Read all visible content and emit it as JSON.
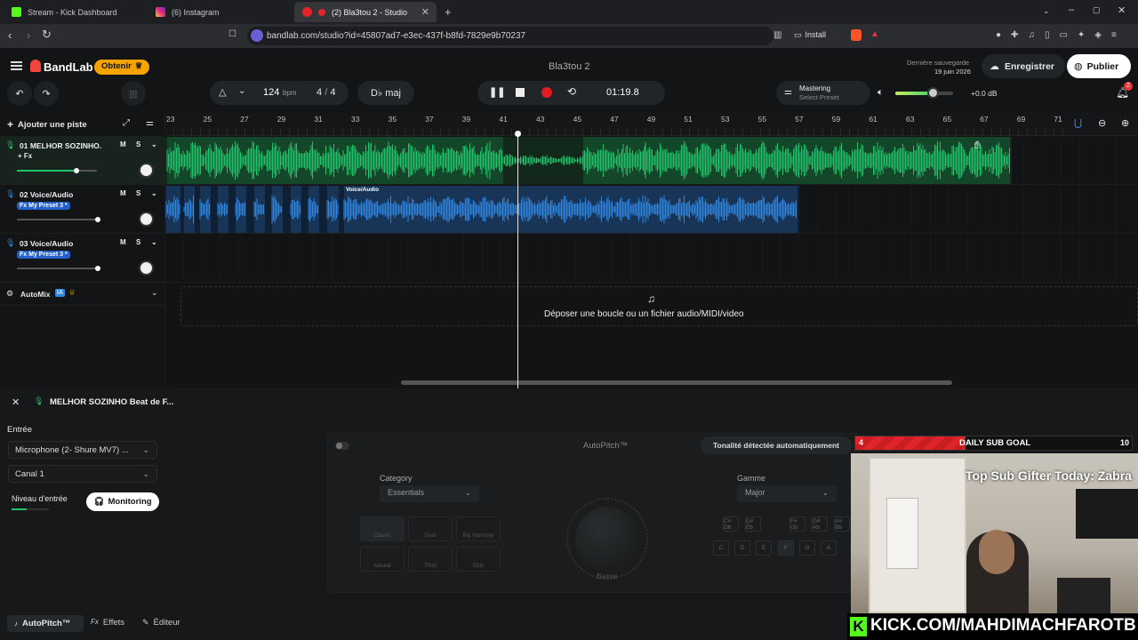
{
  "browser": {
    "tabs": [
      {
        "title": "Stream - Kick Dashboard",
        "favicon": "kick-icon"
      },
      {
        "title": "(6) Instagram",
        "favicon": "instagram-icon"
      },
      {
        "title": "(2) Bla3tou 2 - Studio",
        "favicon": "bandlab-icon"
      }
    ],
    "url": "bandlab.com/studio?id=45807ad7-e3ec-437f-b8fd-7829e9b70237",
    "install_label": "Install"
  },
  "header": {
    "brand": "BandLab",
    "obtenir": "Obtenir",
    "project_title": "Bla3tou 2",
    "last_save_label": "Dernière sauvegarde",
    "last_save_date": "19 juin 2026",
    "save_button": "Enregistrer",
    "publish_button": "Publier"
  },
  "transport": {
    "bpm_value": "124",
    "bpm_unit": "bpm",
    "time_sig_num": "4",
    "time_sig_den": "4",
    "key": "D♭ maj",
    "time": "01:19.8",
    "mastering_label": "Mastering",
    "mastering_preset": "Select Preset",
    "volume_db": "+0.0 dB",
    "notification_count": "2"
  },
  "toolbar": {
    "add_track": "Ajouter une piste"
  },
  "ruler": {
    "bars": [
      "23",
      "25",
      "27",
      "29",
      "31",
      "33",
      "35",
      "37",
      "39",
      "41",
      "43",
      "45",
      "47",
      "49",
      "51",
      "53",
      "55",
      "57",
      "59",
      "61",
      "63",
      "65",
      "67",
      "69",
      "71"
    ]
  },
  "tracks": [
    {
      "name": "01  MELHOR SOZINHO...",
      "fx": "+ Fx",
      "m": "M",
      "s": "S"
    },
    {
      "name": "02  Voice/Audio",
      "fx": "Fx My Preset 3 *",
      "m": "M",
      "s": "S"
    },
    {
      "name": "03  Voice/Audio",
      "fx": "Fx My Preset 3 *",
      "m": "M",
      "s": "S"
    }
  ],
  "clip2_label": "Voice/Audio",
  "automix": {
    "label": "AutoMix",
    "badge": "IA"
  },
  "dropzone": "Déposer une boucle ou un fichier audio/MIDI/video",
  "bottom_panel": {
    "track_title": "MELHOR SOZINHO Beat de F...",
    "input_label": "Entrée",
    "input_device": "Microphone (2- Shure MV7) ...",
    "channel": "Canal 1",
    "input_level_label": "Niveau d'entrée",
    "monitoring": "Monitoring",
    "autopitch_title": "AutoPitch™",
    "detected_key_btn": "Tonalité détectée automatiquement",
    "category_label": "Category",
    "category_value": "Essentials",
    "scale_label": "Gamme",
    "scale_value": "Major",
    "styles": [
      "Classic",
      "Duet",
      "Big Harmony",
      "Natural",
      "Third",
      "Chip"
    ],
    "knob_label": "Basse",
    "keys_top": [
      "C#\nDb",
      "D#\nEb",
      "F#\nGb",
      "G#\nAb",
      "A#\nBb"
    ],
    "keys_bottom": [
      "C",
      "D",
      "E",
      "F",
      "G",
      "A"
    ],
    "tabs": [
      "AutoPitch™",
      "Effets",
      "Éditeur"
    ]
  },
  "overlay": {
    "sub_goal_current": "4",
    "sub_goal_label": "DAILY SUB GOAL",
    "sub_goal_target": "10",
    "sub_goal_progress": 0.4,
    "top_gifter": "Top Sub Gifter Today: Zabra",
    "kick_url": "KICK.COM/MAHDIMACHFAROTB"
  },
  "colors": {
    "track1": "#1fc36a",
    "track2": "#2f86e0",
    "obtenir_bg": "#f5a300",
    "record": "#e01b24"
  }
}
